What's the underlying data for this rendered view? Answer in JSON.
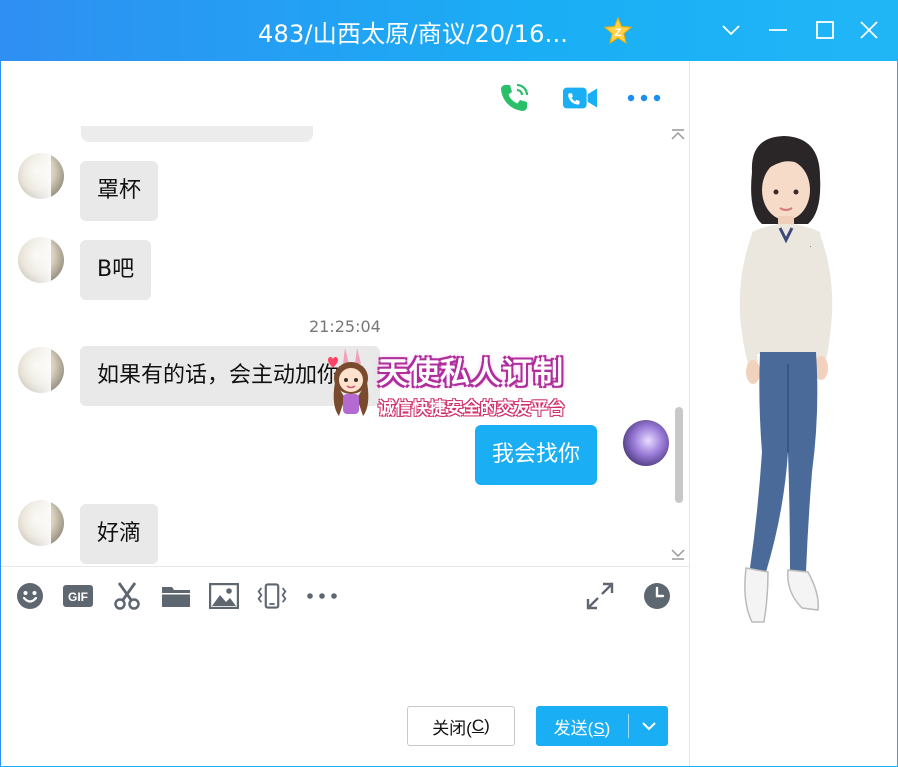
{
  "window": {
    "title": "483/山西太原/商议/20/16...",
    "badge": "Z"
  },
  "messages": {
    "items": [
      {
        "from": "them",
        "text": "罩杯"
      },
      {
        "from": "them",
        "text": "B吧"
      },
      {
        "from": "them",
        "text": "如果有的话，会主动加你"
      },
      {
        "from": "me",
        "text": "我会找你"
      },
      {
        "from": "them",
        "text": "好滴"
      }
    ],
    "timestamp": "21:25:04"
  },
  "watermark": {
    "title": "天使私人订制",
    "subtitle": "诚信快捷安全的交友平台"
  },
  "input": {
    "value": "",
    "placeholder": ""
  },
  "buttons": {
    "close_label": "关闭(",
    "close_key": "C",
    "close_suffix": ")",
    "send_label": "发送(",
    "send_key": "S",
    "send_suffix": ")"
  },
  "colors": {
    "accent": "#1aaef5",
    "title_gradient_start": "#2f8ff2",
    "phone_green": "#2bbf6a",
    "bubble_grey": "#e9e9e9"
  },
  "icons": {
    "call": "phone-call-icon",
    "video": "video-call-icon",
    "more": "more-dots-icon",
    "emoji": "emoji-icon",
    "gif": "gif-icon",
    "screenshot": "scissors-icon",
    "file": "folder-icon",
    "image": "image-icon",
    "shake": "shake-icon",
    "tools_more": "more-dots-icon",
    "expand": "expand-icon",
    "history": "clock-icon"
  }
}
